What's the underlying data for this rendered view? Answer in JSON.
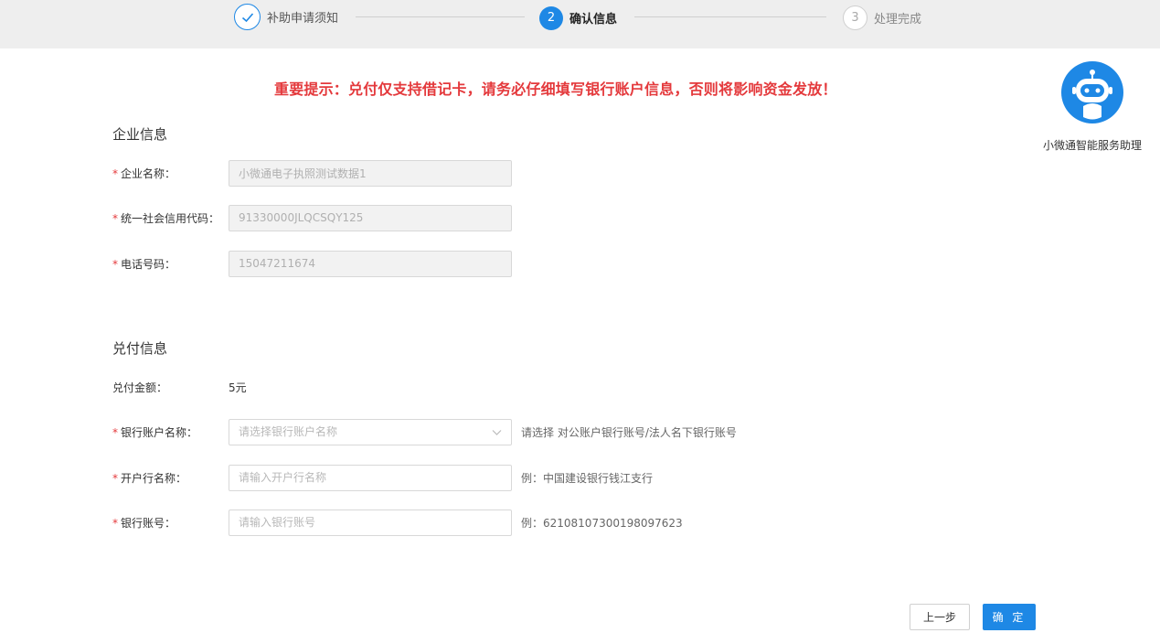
{
  "steps": [
    {
      "label": "补助申请须知",
      "marker": "✓",
      "state": "done"
    },
    {
      "label": "确认信息",
      "marker": "2",
      "state": "active"
    },
    {
      "label": "处理完成",
      "marker": "3",
      "state": "todo"
    }
  ],
  "notice": "重要提示：兑付仅支持借记卡，请务必仔细填写银行账户信息，否则将影响资金发放！",
  "assistant": {
    "name": "小微通智能服务助理"
  },
  "company_section": {
    "title": "企业信息",
    "fields": [
      {
        "label": "企业名称：",
        "value": "小微通电子执照测试数据1"
      },
      {
        "label": "统一社会信用代码：",
        "value": "91330000JLQCSQY125"
      },
      {
        "label": "电话号码：",
        "value": "15047211674"
      }
    ]
  },
  "payment_section": {
    "title": "兑付信息",
    "amount_label": "兑付金额：",
    "amount_value": "5元",
    "bank_account_name": {
      "label": "银行账户名称：",
      "placeholder": "请选择银行账户名称",
      "hint": "请选择 对公账户银行账号/法人名下银行账号"
    },
    "bank_branch": {
      "label": "开户行名称：",
      "placeholder": "请输入开户行名称",
      "hint": "例：中国建设银行钱江支行"
    },
    "bank_number": {
      "label": "银行账号：",
      "placeholder": "请输入银行账号",
      "hint": "例：62108107300198097623"
    }
  },
  "required_mark": "*",
  "buttons": {
    "prev": "上一步",
    "confirm": "确 定"
  },
  "colors": {
    "primary": "#1e88e5",
    "warning": "#e4393c"
  }
}
